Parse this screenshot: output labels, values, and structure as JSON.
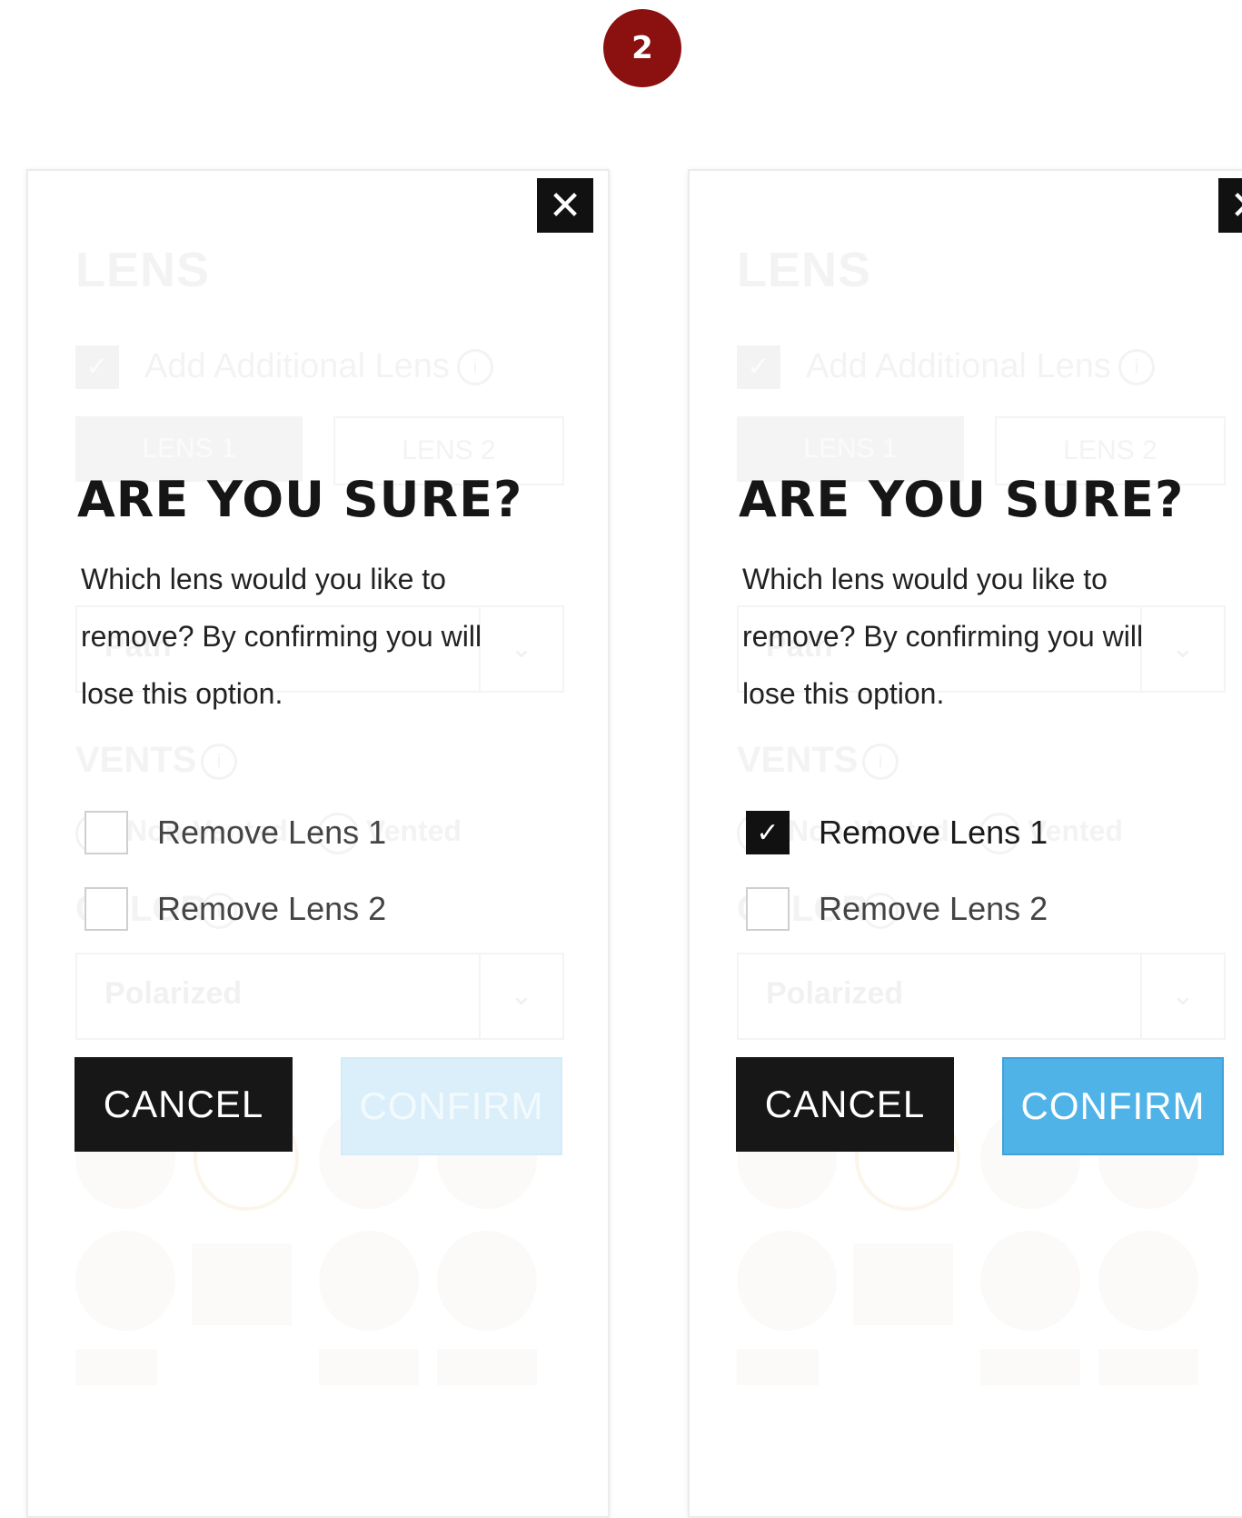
{
  "step_badge": "2",
  "panels": [
    {
      "background": {
        "section_title": "LENS",
        "add_lens_label": "Add Additional Lens",
        "tab1": "LENS 1",
        "tab2": "LENS 2",
        "path_value": "Path",
        "vents_label": "VENTS",
        "non_vented": "Non-Vented",
        "vented": "Vented",
        "color_label": "COLOR",
        "color_value": "Polarized"
      },
      "modal": {
        "title": "ARE YOU SURE?",
        "body": "Which lens would you like to remove? By confirming you will lose this option.",
        "options": [
          {
            "label": "Remove Lens 1",
            "checked": false
          },
          {
            "label": "Remove Lens 2",
            "checked": false
          }
        ],
        "cancel_label": "CANCEL",
        "confirm_label": "CONFIRM",
        "confirm_enabled": false
      }
    },
    {
      "background": {
        "section_title": "LENS",
        "add_lens_label": "Add Additional Lens",
        "tab1": "LENS 1",
        "tab2": "LENS 2",
        "path_value": "Path",
        "vents_label": "VENTS",
        "non_vented": "Non-Vented",
        "vented": "Vented",
        "color_label": "COLOR",
        "color_value": "Polarized"
      },
      "modal": {
        "title": "ARE YOU SURE?",
        "body": "Which lens would you like to remove? By confirming you will lose this option.",
        "options": [
          {
            "label": "Remove Lens 1",
            "checked": true
          },
          {
            "label": "Remove Lens 2",
            "checked": false
          }
        ],
        "cancel_label": "CANCEL",
        "confirm_label": "CONFIRM",
        "confirm_enabled": true
      }
    }
  ],
  "icons": {
    "close": "close-icon",
    "check": "checkmark-icon",
    "info": "info-icon",
    "chevron": "chevron-down-icon"
  },
  "colors": {
    "badge": "#8b1111",
    "confirm_enabled": "#4fb3e8",
    "confirm_disabled": "#dbeffa",
    "cancel": "#171717"
  }
}
